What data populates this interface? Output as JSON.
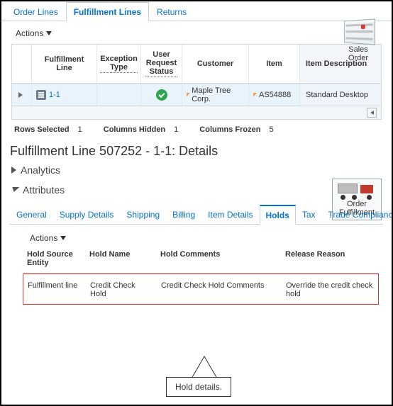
{
  "topTabs": {
    "t0": "Order Lines",
    "t1": "Fulfillment Lines",
    "t2": "Returns",
    "active": 1
  },
  "salesOrderLabel": "Sales Order",
  "actionsLabel": "Actions",
  "grid": {
    "headers": {
      "fulfillmentLine": "Fulfillment Line",
      "exceptionType": "Exception Type",
      "userRequestStatus": "User Request Status",
      "customer": "Customer",
      "item": "Item",
      "itemDescription": "Item Description"
    },
    "row": {
      "line": "1-1",
      "customer": "Maple Tree Corp.",
      "item": "AS54888",
      "itemDescription": "Standard Desktop"
    }
  },
  "status": {
    "rowsSelectedLabel": "Rows Selected",
    "rowsSelected": "1",
    "columnsHiddenLabel": "Columns Hidden",
    "columnsHidden": "1",
    "columnsFrozenLabel": "Columns Frozen",
    "columnsFrozen": "5"
  },
  "detailsTitle": "Fulfillment Line 507252 - 1-1: Details",
  "orderFulfillLabel": "Order Fulfillment",
  "analyticsLabel": "Analytics",
  "attributesLabel": "Attributes",
  "subTabs": {
    "t0": "General",
    "t1": "Supply Details",
    "t2": "Shipping",
    "t3": "Billing",
    "t4": "Item Details",
    "t5": "Holds",
    "t6": "Tax",
    "t7": "Trade Compliance",
    "active": 5
  },
  "holds": {
    "headers": {
      "holdSourceEntity": "Hold Source Entity",
      "holdName": "Hold Name",
      "holdComments": "Hold Comments",
      "releaseReason": "Release Reason"
    },
    "row": {
      "entity": "Fulfillment line",
      "name": "Credit Check Hold",
      "comments": "Credit Check Hold Comments",
      "reason": "Override the credit check hold"
    }
  },
  "callout": "Hold details."
}
